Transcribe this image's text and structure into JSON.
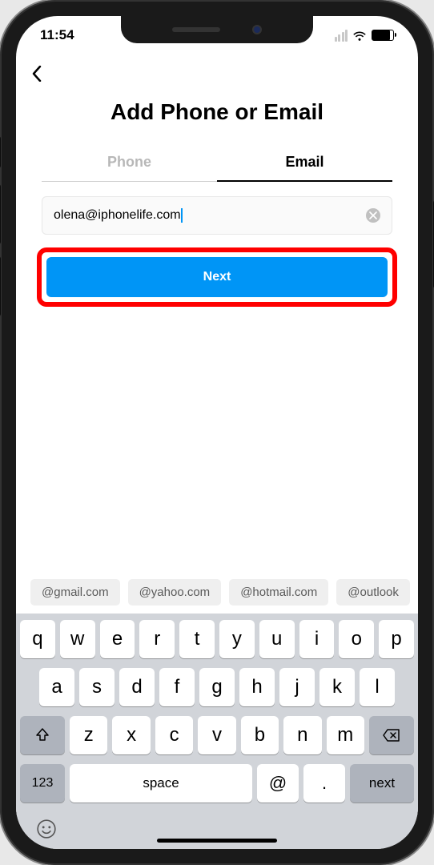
{
  "status": {
    "time": "11:54"
  },
  "page": {
    "title": "Add Phone or Email"
  },
  "tabs": {
    "phone": "Phone",
    "email": "Email",
    "active": "Email"
  },
  "input": {
    "value": "olena@iphonelife.com",
    "clear_icon_label": "clear"
  },
  "button": {
    "next": "Next"
  },
  "suggestions": [
    "@gmail.com",
    "@yahoo.com",
    "@hotmail.com",
    "@outlook"
  ],
  "keyboard": {
    "row1": [
      "q",
      "w",
      "e",
      "r",
      "t",
      "y",
      "u",
      "i",
      "o",
      "p"
    ],
    "row2": [
      "a",
      "s",
      "d",
      "f",
      "g",
      "h",
      "j",
      "k",
      "l"
    ],
    "row3": [
      "z",
      "x",
      "c",
      "v",
      "b",
      "n",
      "m"
    ],
    "numkey": "123",
    "space": "space",
    "at": "@",
    "dot": ".",
    "next": "next"
  }
}
